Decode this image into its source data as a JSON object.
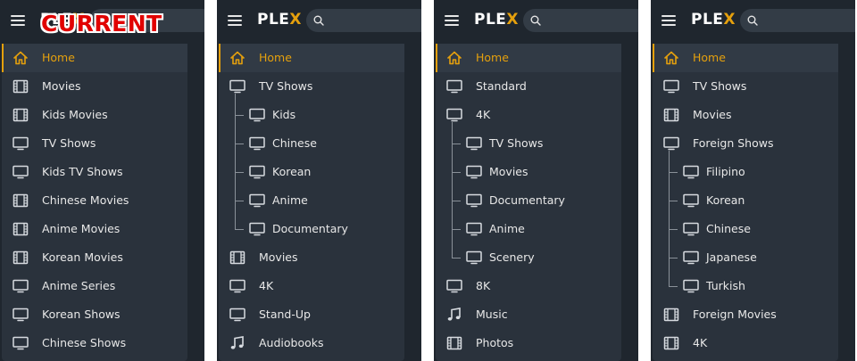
{
  "colors": {
    "accent": "#e5a00d",
    "panel_bg": "#1f262e",
    "nav_bg": "#2a323c",
    "text": "#e8e8e8"
  },
  "badge": "CURRENT",
  "logo": {
    "text_main": "PLE",
    "text_accent": "X"
  },
  "panels": [
    {
      "items": [
        {
          "label": "Home",
          "icon": "home-icon",
          "active": true
        },
        {
          "label": "Movies",
          "icon": "film-icon"
        },
        {
          "label": "Kids Movies",
          "icon": "film-icon"
        },
        {
          "label": "TV Shows",
          "icon": "tv-icon"
        },
        {
          "label": "Kids TV Shows",
          "icon": "tv-icon"
        },
        {
          "label": "Chinese Movies",
          "icon": "film-icon"
        },
        {
          "label": "Anime Movies",
          "icon": "film-icon"
        },
        {
          "label": "Korean Movies",
          "icon": "film-icon"
        },
        {
          "label": "Anime Series",
          "icon": "tv-icon"
        },
        {
          "label": "Korean Shows",
          "icon": "tv-icon"
        },
        {
          "label": "Chinese Shows",
          "icon": "tv-icon"
        }
      ]
    },
    {
      "items": [
        {
          "label": "Home",
          "icon": "home-icon",
          "active": true
        },
        {
          "label": "TV Shows",
          "icon": "tv-icon"
        },
        {
          "label": "Kids",
          "icon": "tv-icon",
          "child": true
        },
        {
          "label": "Chinese",
          "icon": "tv-icon",
          "child": true
        },
        {
          "label": "Korean",
          "icon": "tv-icon",
          "child": true
        },
        {
          "label": "Anime",
          "icon": "tv-icon",
          "child": true
        },
        {
          "label": "Documentary",
          "icon": "tv-icon",
          "child": true
        },
        {
          "label": "Movies",
          "icon": "film-icon"
        },
        {
          "label": "4K",
          "icon": "tv-icon"
        },
        {
          "label": "Stand-Up",
          "icon": "tv-icon"
        },
        {
          "label": "Audiobooks",
          "icon": "music-icon"
        }
      ]
    },
    {
      "items": [
        {
          "label": "Home",
          "icon": "home-icon",
          "active": true
        },
        {
          "label": "Standard",
          "icon": "tv-icon"
        },
        {
          "label": "4K",
          "icon": "tv-icon"
        },
        {
          "label": "TV Shows",
          "icon": "tv-icon",
          "child": true
        },
        {
          "label": "Movies",
          "icon": "tv-icon",
          "child": true
        },
        {
          "label": "Documentary",
          "icon": "tv-icon",
          "child": true
        },
        {
          "label": "Anime",
          "icon": "tv-icon",
          "child": true
        },
        {
          "label": "Scenery",
          "icon": "tv-icon",
          "child": true
        },
        {
          "label": "8K",
          "icon": "tv-icon"
        },
        {
          "label": "Music",
          "icon": "music-icon"
        },
        {
          "label": "Photos",
          "icon": "film-icon"
        }
      ]
    },
    {
      "items": [
        {
          "label": "Home",
          "icon": "home-icon",
          "active": true
        },
        {
          "label": "TV Shows",
          "icon": "tv-icon"
        },
        {
          "label": "Movies",
          "icon": "film-icon"
        },
        {
          "label": "Foreign Shows",
          "icon": "tv-icon"
        },
        {
          "label": "Filipino",
          "icon": "tv-icon",
          "child": true
        },
        {
          "label": "Korean",
          "icon": "tv-icon",
          "child": true
        },
        {
          "label": "Chinese",
          "icon": "tv-icon",
          "child": true
        },
        {
          "label": "Japanese",
          "icon": "tv-icon",
          "child": true
        },
        {
          "label": "Turkish",
          "icon": "tv-icon",
          "child": true
        },
        {
          "label": "Foreign Movies",
          "icon": "film-icon"
        },
        {
          "label": "4K",
          "icon": "film-icon"
        }
      ]
    }
  ]
}
